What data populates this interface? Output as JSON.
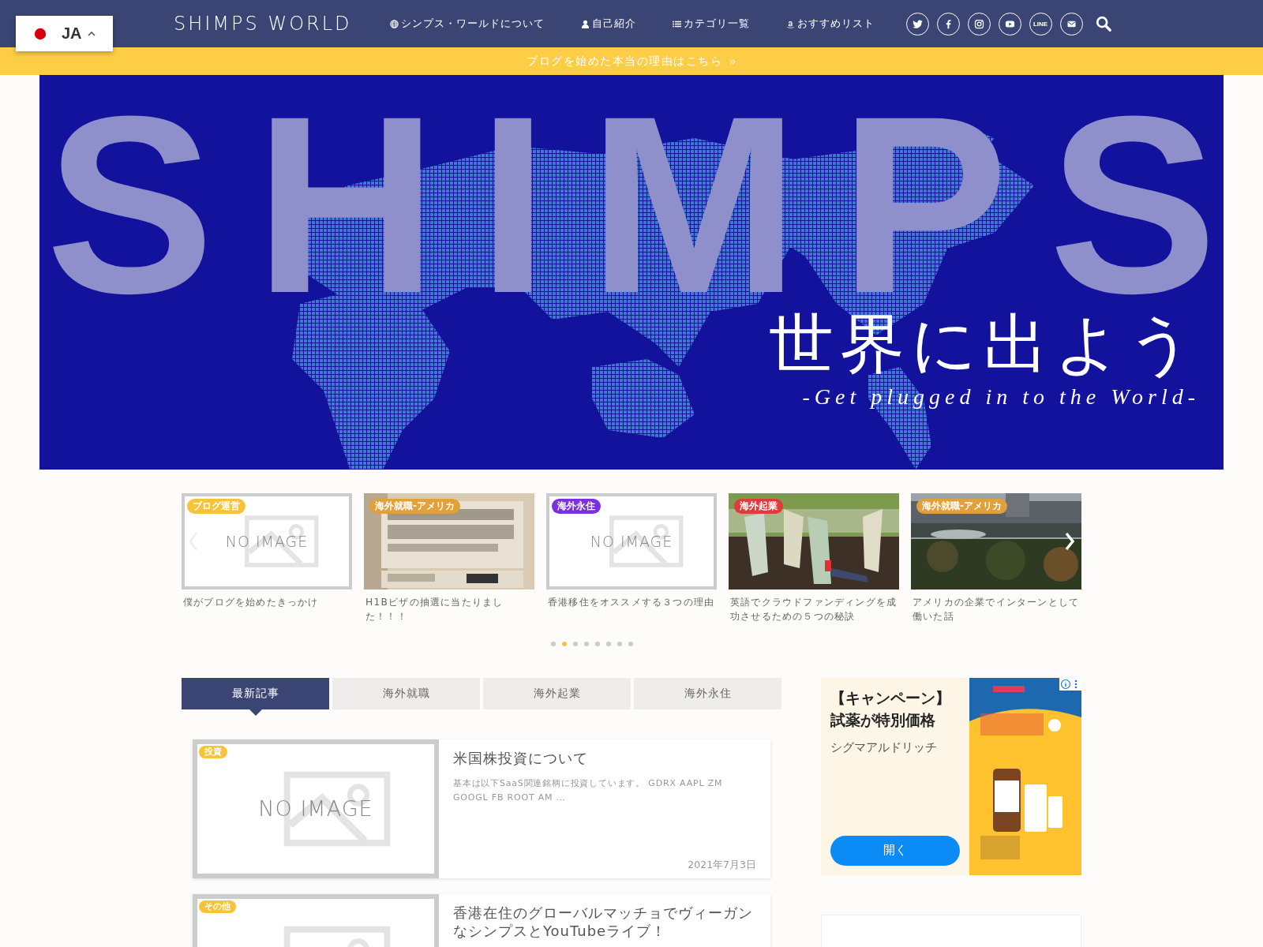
{
  "language_switcher": {
    "code": "JA",
    "expanded": false
  },
  "site_title": "SHIMPS WORLD",
  "nav": [
    {
      "kind": "globe",
      "label": "シンプス・ワールドについて"
    },
    {
      "kind": "person",
      "label": "自己紹介"
    },
    {
      "kind": "list",
      "label": "カテゴリ一覧"
    },
    {
      "kind": "amazon",
      "label": "おすすめリスト"
    }
  ],
  "social": [
    {
      "kind": "twitter"
    },
    {
      "kind": "facebook"
    },
    {
      "kind": "instagram"
    },
    {
      "kind": "youtube"
    },
    {
      "kind": "line",
      "label": "LINE"
    },
    {
      "kind": "mail"
    }
  ],
  "announcement": {
    "text": "ブログを始めた本当の理由はこちら",
    "arrow": "»"
  },
  "hero": {
    "letters": [
      "S",
      "H",
      "I",
      "M",
      "P",
      "S"
    ],
    "headline": "世界に出よう",
    "tagline": "-Get plugged in to the World-"
  },
  "carousel": {
    "slides": [
      {
        "category": "ブログ運営",
        "color": "#f6c33b",
        "title": "僕がブログを始めたきっかけ",
        "kind": "placeholder",
        "placeholder": "NO IMAGE"
      },
      {
        "category": "海外就職-アメリカ",
        "color": "#e0a03a",
        "title": "H1Bビザの抽選に当たりました！！！",
        "kind": "picture"
      },
      {
        "category": "海外永住",
        "color": "#7b2fe0",
        "title": "香港移住をオススメする３つの理由",
        "kind": "placeholder",
        "placeholder": "NO IMAGE"
      },
      {
        "category": "海外起業",
        "color": "#e03a3a",
        "title": "英語でクラウドファンディングを成功させるための５つの秘訣",
        "kind": "picture"
      },
      {
        "category": "海外就職-アメリカ",
        "color": "#e0a03a",
        "title": "アメリカの企業でインターンとして働いた話",
        "kind": "picture"
      }
    ],
    "dots": [
      {
        "selected": false
      },
      {
        "selected": true
      },
      {
        "selected": false
      },
      {
        "selected": false
      },
      {
        "selected": false
      },
      {
        "selected": false
      },
      {
        "selected": false
      },
      {
        "selected": false
      }
    ]
  },
  "tabs": [
    {
      "label": "最新記事",
      "selected": true
    },
    {
      "label": "海外就職",
      "selected": false
    },
    {
      "label": "海外起業",
      "selected": false
    },
    {
      "label": "海外永住",
      "selected": false
    }
  ],
  "articles": [
    {
      "category": "投資",
      "color": "#f6c33b",
      "title": "米国株投資について",
      "excerpt": "基本は以下SaaS関連銘柄に投資しています。 GDRX AAPL ZM GOOGL FB ROOT AM …",
      "date": "2021年7月3日",
      "placeholder": "NO IMAGE"
    },
    {
      "category": "その他",
      "color": "#f6c33b",
      "title": "香港在住のグローバルマッチョでヴィーガンなシンプスとYouTubeライブ！"
    }
  ],
  "ad": {
    "headline": [
      "【キャンペーン】",
      "試薬が特別価格"
    ],
    "advertiser": "シグマアルドリッチ",
    "button": "開く"
  }
}
